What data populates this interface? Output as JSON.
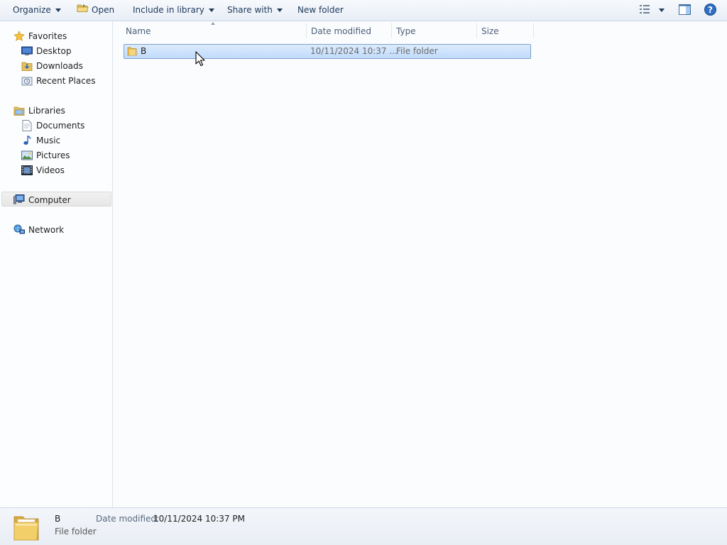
{
  "toolbar": {
    "organize": "Organize",
    "open": "Open",
    "include_in_library": "Include in library",
    "share_with": "Share with",
    "new_folder": "New folder"
  },
  "nav": {
    "favorites": {
      "label": "Favorites",
      "items": [
        "Desktop",
        "Downloads",
        "Recent Places"
      ]
    },
    "libraries": {
      "label": "Libraries",
      "items": [
        "Documents",
        "Music",
        "Pictures",
        "Videos"
      ]
    },
    "computer": "Computer",
    "network": "Network"
  },
  "columns": [
    "Name",
    "Date modified",
    "Type",
    "Size"
  ],
  "files": [
    {
      "name": "B",
      "date_modified": "10/11/2024 10:37 ...",
      "type": "File folder",
      "size": ""
    }
  ],
  "details": {
    "name": "B",
    "type": "File folder",
    "date_label": "Date modified:",
    "date_value": "10/11/2024 10:37 PM"
  },
  "colors": {
    "selection": "#cce0fb",
    "toolbar_text": "#1e395b",
    "folder_yellow": "#f0c75a"
  }
}
